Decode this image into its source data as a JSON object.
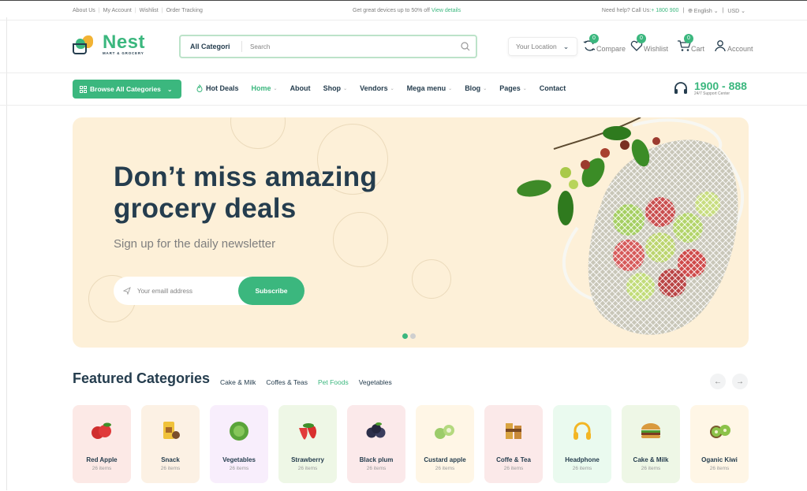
{
  "topbar": {
    "links": [
      "About Us",
      "My Account",
      "Wishlist",
      "Order Tracking"
    ],
    "promo": "Get great devices up to 50% off",
    "promo_link": "View details",
    "help": "Need help? Call Us:",
    "phone": "+ 1800 900",
    "language": "English",
    "currency": "USD"
  },
  "header": {
    "logo_name": "Nest",
    "logo_tag": "MART & GROCERY",
    "search_category": "All Categori",
    "search_placeholder": "Search",
    "location": "Your Location",
    "compare": {
      "label": "Compare",
      "count": "0"
    },
    "wishlist": {
      "label": "Wishlist",
      "count": "0"
    },
    "cart": {
      "label": "Cart",
      "count": "0"
    },
    "account": "Account"
  },
  "nav": {
    "browse": "Browse All Categories",
    "items": [
      {
        "label": "Hot Deals"
      },
      {
        "label": "Home"
      },
      {
        "label": "About"
      },
      {
        "label": "Shop"
      },
      {
        "label": "Vendors"
      },
      {
        "label": "Mega menu"
      },
      {
        "label": "Blog"
      },
      {
        "label": "Pages"
      },
      {
        "label": "Contact"
      }
    ],
    "hotline": "1900 - 888",
    "hotline_sub": "24/7 Support Center"
  },
  "hero": {
    "line1": "Don’t miss amazing",
    "line2": "grocery deals",
    "subtitle": "Sign up for the daily newsletter",
    "email_placeholder": "Your emaill address",
    "subscribe": "Subscribe"
  },
  "featured": {
    "title": "Featured Categories",
    "tabs": [
      "Cake & Milk",
      "Coffes & Teas",
      "Pet Foods",
      "Vegetables"
    ],
    "categories": [
      {
        "name": "Red Apple",
        "count": "26 items",
        "bg": "#fce9e6"
      },
      {
        "name": "Snack",
        "count": "26 items",
        "bg": "#fcf1e4"
      },
      {
        "name": "Vegetables",
        "count": "26 items",
        "bg": "#f8eefc"
      },
      {
        "name": "Strawberry",
        "count": "26 items",
        "bg": "#eef7e6"
      },
      {
        "name": "Black plum",
        "count": "26 items",
        "bg": "#fbe9ea"
      },
      {
        "name": "Custard apple",
        "count": "26 items",
        "bg": "#fff6e6"
      },
      {
        "name": "Coffe & Tea",
        "count": "26 items",
        "bg": "#fbe9e9"
      },
      {
        "name": "Headphone",
        "count": "26 items",
        "bg": "#eafaef"
      },
      {
        "name": "Cake & Milk",
        "count": "26 items",
        "bg": "#eef7e6"
      },
      {
        "name": "Oganic Kiwi",
        "count": "26 items",
        "bg": "#fff6e6"
      }
    ]
  },
  "colors": {
    "accent": "#3bb77e",
    "dark": "#253d4e",
    "hero_bg": "#fdf0d8"
  }
}
